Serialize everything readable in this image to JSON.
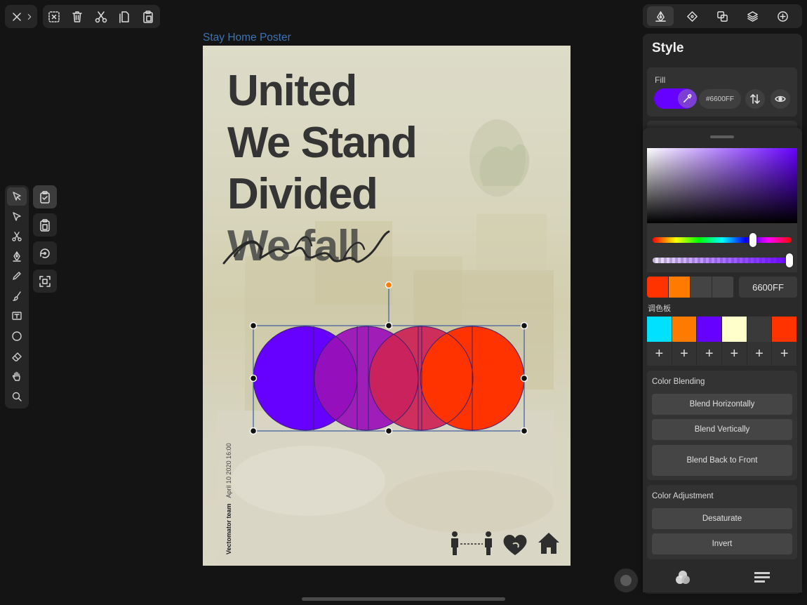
{
  "document": {
    "title": "Stay Home Poster"
  },
  "toolbar": {
    "close_icon": "close-icon",
    "edit_icons": [
      "deselect-icon",
      "trash-icon",
      "scissors-icon",
      "copy-icon",
      "paste-icon"
    ]
  },
  "tools": [
    "select",
    "direct-select",
    "scissors",
    "pen",
    "pencil",
    "brush",
    "text",
    "ellipse",
    "eraser",
    "hand",
    "zoom"
  ],
  "actions": [
    "clipboard-check",
    "paste",
    "rotate",
    "fit-screen"
  ],
  "poster": {
    "lines": [
      "United",
      "We Stand",
      "Divided",
      "We fall"
    ],
    "credit_name": "Vectomator team",
    "credit_date": "April 10 2020 16:00",
    "circle_colors": [
      "#6600ff",
      "#9a10b8",
      "#cc2255",
      "#ff3300"
    ]
  },
  "panel": {
    "tabs": [
      "style",
      "arrange",
      "path-ops",
      "layers",
      "add"
    ],
    "title": "Style",
    "fill_label": "Fill",
    "fill_color": "#6600FF",
    "fill_hex": "#6600FF"
  },
  "picker": {
    "hex_value": "6600FF",
    "hue": 0.72,
    "alpha": 1.0,
    "recent_colors": [
      "#ff3300",
      "#ff7a00",
      "#444444",
      "#444444"
    ],
    "palette_label": "调色板",
    "palette_colors": [
      "#00e0ff",
      "#ff7a00",
      "#6600ff",
      "#ffffcc",
      "#3a3a3a",
      "#ff3300"
    ],
    "plus_label": "+",
    "blending": {
      "title": "Color Blending",
      "buttons": [
        "Blend Horizontally",
        "Blend Vertically",
        "Blend Back to Front"
      ]
    },
    "adjustment": {
      "title": "Color Adjustment",
      "buttons": [
        "Desaturate",
        "Invert"
      ]
    }
  }
}
